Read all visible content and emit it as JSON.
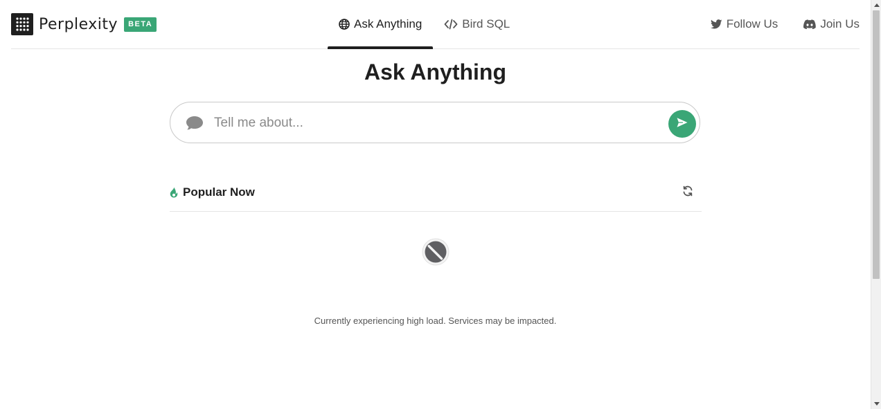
{
  "brand": {
    "name": "Perplexity",
    "badge": "BETA",
    "logo_icon": "grid-dots-logo-icon"
  },
  "nav": {
    "tabs": [
      {
        "label": "Ask Anything",
        "icon": "globe-icon",
        "active": true
      },
      {
        "label": "Bird SQL",
        "icon": "code-icon",
        "active": false
      }
    ],
    "links": [
      {
        "label": "Follow Us",
        "icon": "twitter-icon"
      },
      {
        "label": "Join Us",
        "icon": "discord-icon"
      }
    ]
  },
  "main": {
    "title": "Ask Anything",
    "search": {
      "placeholder": "Tell me about...",
      "value": ""
    },
    "popular": {
      "label": "Popular Now"
    },
    "notice": "Currently experiencing high load. Services may be impacted."
  },
  "colors": {
    "accent": "#3aa676",
    "text": "#1f1f1f",
    "muted": "#555555"
  }
}
